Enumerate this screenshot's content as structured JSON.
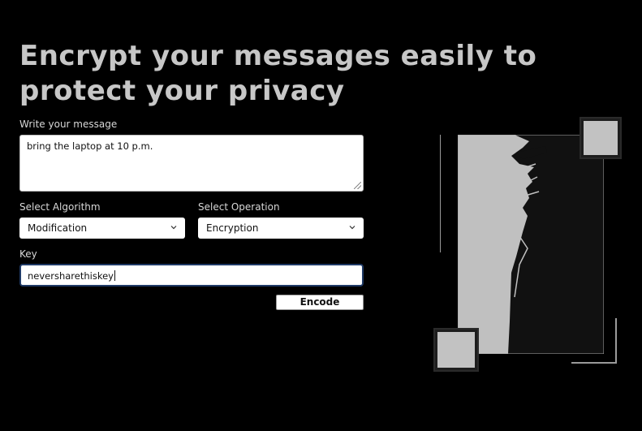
{
  "headline": "Encrypt your messages easily to protect your privacy",
  "message": {
    "label": "Write your message",
    "value": "bring the laptop at 10 p.m."
  },
  "algorithm": {
    "label": "Select Algorithm",
    "selected": "Modification"
  },
  "operation": {
    "label": "Select Operation",
    "selected": "Encryption"
  },
  "key": {
    "label": "Key",
    "value": "neversharethiskey"
  },
  "encode_button": "Encode",
  "illustration": {
    "icon": "spy-silhouette-icon"
  }
}
